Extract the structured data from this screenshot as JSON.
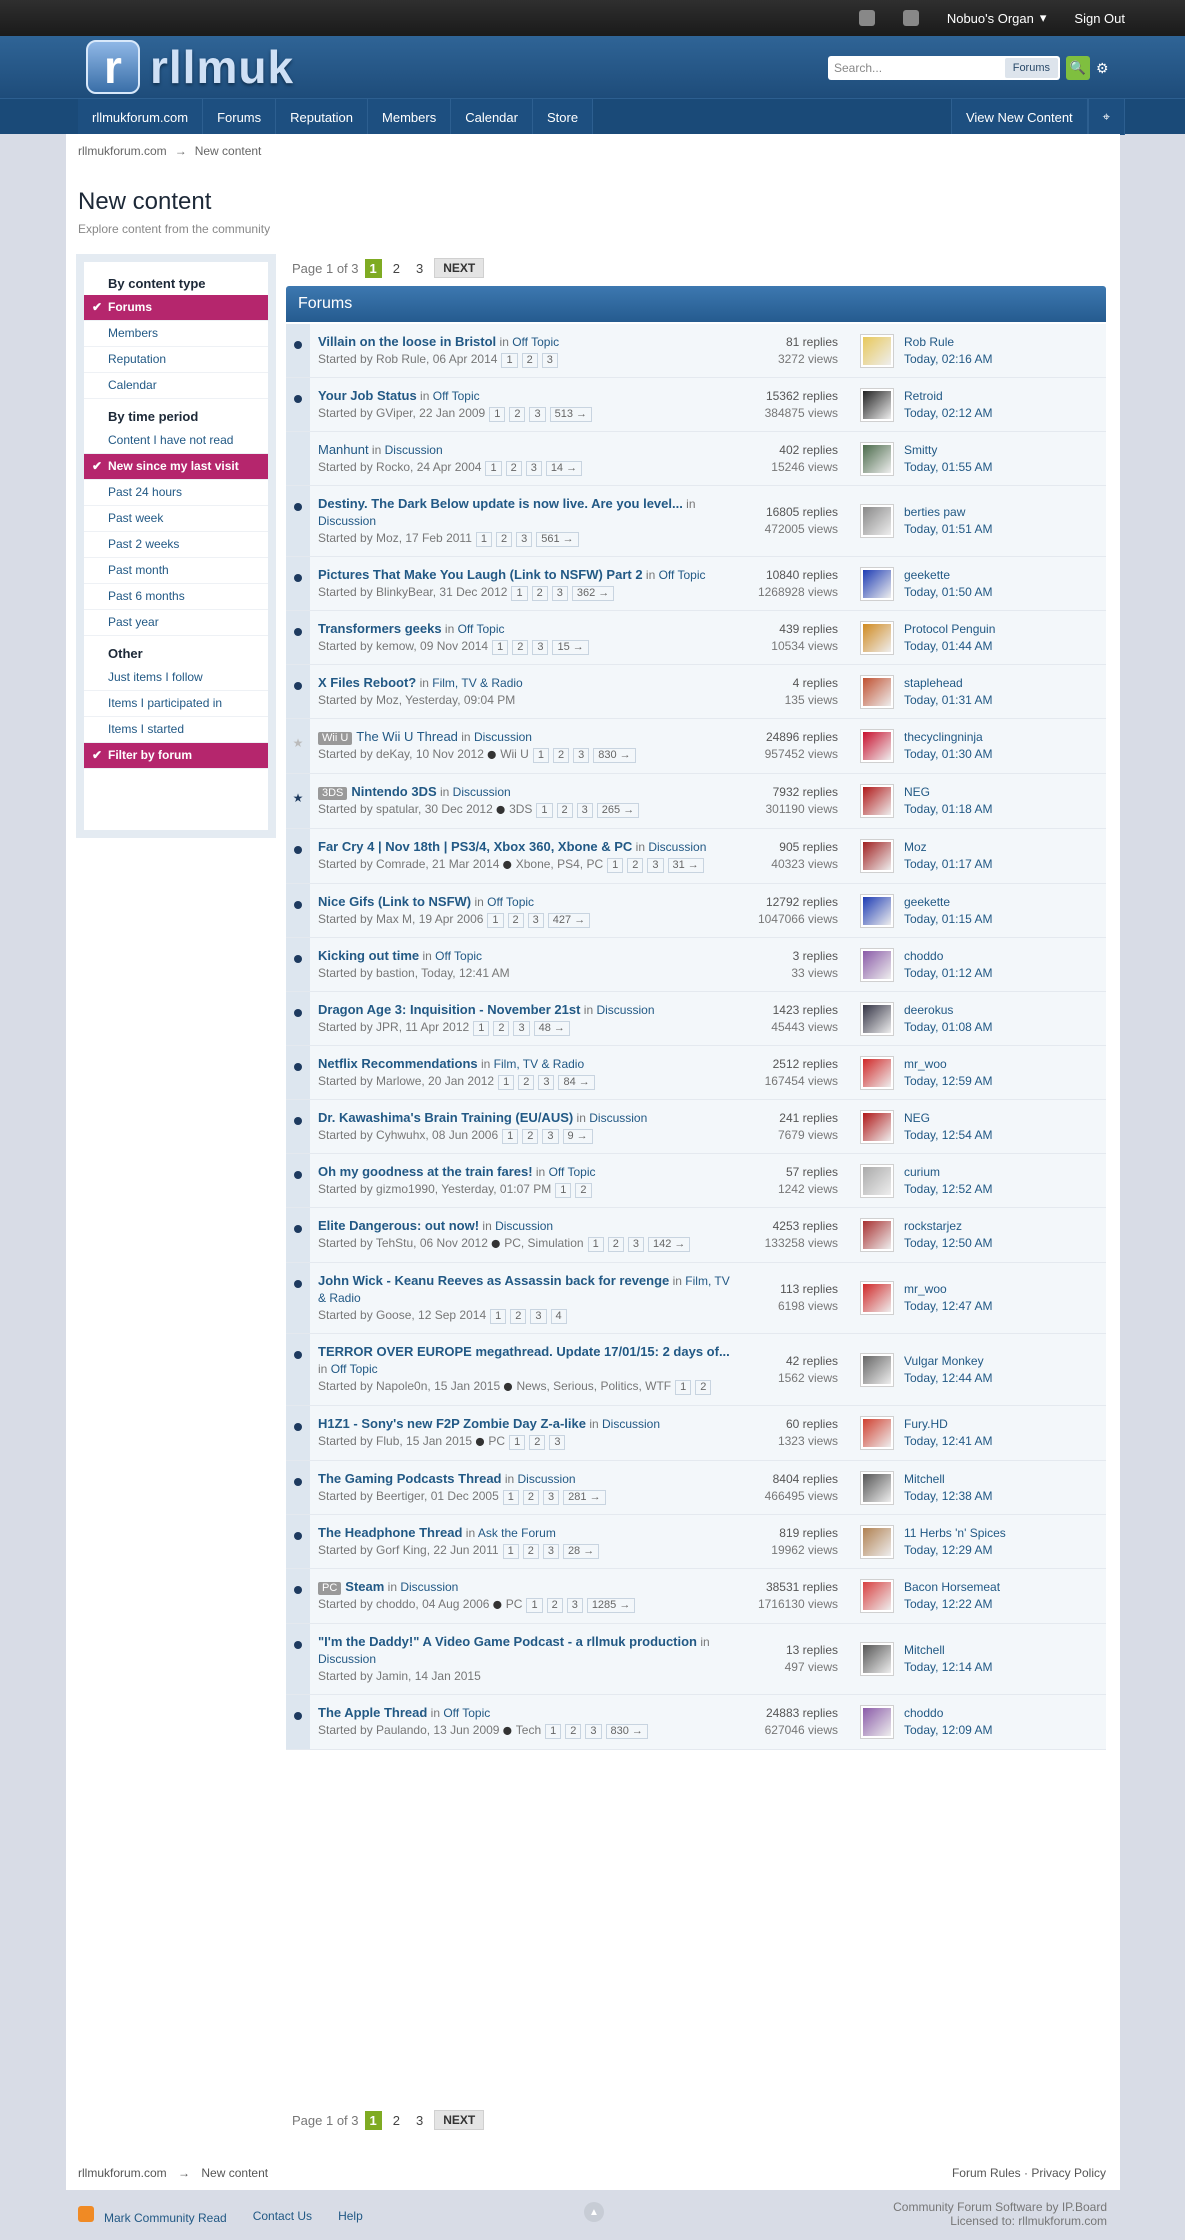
{
  "topbar": {
    "user": "Nobuo's Organ",
    "signout": "Sign Out"
  },
  "header": {
    "logo_letter": "r",
    "logo_text": "rllmuk",
    "search_placeholder": "Search...",
    "search_scope": "Forums"
  },
  "nav": {
    "items": [
      "rllmukforum.com",
      "Forums",
      "Reputation",
      "Members",
      "Calendar",
      "Store"
    ],
    "view_new": "View New Content"
  },
  "breadcrumb": {
    "home": "rllmukforum.com",
    "sep": "→",
    "current": "New content"
  },
  "page": {
    "title": "New content",
    "subtitle": "Explore content from the community"
  },
  "sidebar": {
    "h1": "By content type",
    "type": [
      "Forums",
      "Members",
      "Reputation",
      "Calendar"
    ],
    "h2": "By time period",
    "time": [
      "Content I have not read",
      "New since my last visit",
      "Past 24 hours",
      "Past week",
      "Past 2 weeks",
      "Past month",
      "Past 6 months",
      "Past year"
    ],
    "h3": "Other",
    "other": [
      "Just items I follow",
      "Items I participated in",
      "Items I started",
      "Filter by forum"
    ]
  },
  "pager": {
    "label": "Page 1 of 3",
    "pages": [
      "1",
      "2",
      "3"
    ],
    "next": "NEXT"
  },
  "section": "Forums",
  "topics": [
    {
      "title": "Villain on the loose in Bristol",
      "forum": "Off Topic",
      "starter": "Started by Rob Rule, 06 Apr 2014",
      "pages": [
        "1",
        "2",
        "3"
      ],
      "replies": "81 replies",
      "views": "3272 views",
      "last": "Rob Rule",
      "time": "Today, 02:16 AM",
      "c": "#e8c85a"
    },
    {
      "title": "Your Job Status",
      "forum": "Off Topic",
      "starter": "Started by GViper, 22 Jan 2009",
      "pages": [
        "1",
        "2",
        "3",
        "513 →"
      ],
      "replies": "15362 replies",
      "views": "384875 views",
      "last": "Retroid",
      "time": "Today, 02:12 AM",
      "c": "#222"
    },
    {
      "title": "Manhunt",
      "forum": "Discussion",
      "starter": "Started by Rocko, 24 Apr 2004",
      "pages": [
        "1",
        "2",
        "3",
        "14 →"
      ],
      "replies": "402 replies",
      "views": "15246 views",
      "last": "Smitty",
      "time": "Today, 01:55 AM",
      "c": "#4a6a4a",
      "read": true
    },
    {
      "title": "Destiny. The Dark Below update is now live. Are you level...",
      "forum": "Discussion",
      "starter": "Started by Moz, 17 Feb 2011",
      "pages": [
        "1",
        "2",
        "3",
        "561 →"
      ],
      "replies": "16805 replies",
      "views": "472005 views",
      "last": "berties paw",
      "time": "Today, 01:51 AM",
      "c": "#888"
    },
    {
      "title": "Pictures That Make You Laugh (Link to NSFW) Part 2",
      "forum": "Off Topic",
      "starter": "Started by BlinkyBear, 31 Dec 2012",
      "pages": [
        "1",
        "2",
        "3",
        "362 →"
      ],
      "replies": "10840 replies",
      "views": "1268928 views",
      "last": "geekette",
      "time": "Today, 01:50 AM",
      "c": "#1e3cb4"
    },
    {
      "title": "Transformers geeks",
      "forum": "Off Topic",
      "starter": "Started by kemow, 09 Nov 2014",
      "pages": [
        "1",
        "2",
        "3",
        "15 →"
      ],
      "replies": "439 replies",
      "views": "10534 views",
      "last": "Protocol Penguin",
      "time": "Today, 01:44 AM",
      "c": "#d08a20"
    },
    {
      "title": "X Files Reboot?",
      "forum": "Film, TV & Radio",
      "starter": "Started by Moz, Yesterday, 09:04 PM",
      "pages": [],
      "replies": "4 replies",
      "views": "135 views",
      "last": "staplehead",
      "time": "Today, 01:31 AM",
      "c": "#c05030"
    },
    {
      "prefix": "Wii U",
      "title": "The Wii U Thread",
      "forum": "Discussion",
      "starter": "Started by deKay, 10 Nov 2012",
      "tags": "Wii U",
      "pages": [
        "1",
        "2",
        "3",
        "830 →"
      ],
      "replies": "24896 replies",
      "views": "957452 views",
      "last": "thecyclingninja",
      "time": "Today, 01:30 AM",
      "c": "#c8102e",
      "read": true,
      "star": "grey"
    },
    {
      "prefix": "3DS",
      "title": "Nintendo 3DS",
      "forum": "Discussion",
      "starter": "Started by spatular, 30 Dec 2012",
      "tags": "3DS",
      "pages": [
        "1",
        "2",
        "3",
        "265 →"
      ],
      "replies": "7932 replies",
      "views": "301190 views",
      "last": "NEG",
      "time": "Today, 01:18 AM",
      "c": "#b01818",
      "star": "blue"
    },
    {
      "title": "Far Cry 4 | Nov 18th | PS3/4, Xbox 360, Xbone & PC",
      "forum": "Discussion",
      "starter": "Started by Comrade, 21 Mar 2014",
      "tags": "Xbone, PS4, PC",
      "pages": [
        "1",
        "2",
        "3",
        "31 →"
      ],
      "replies": "905 replies",
      "views": "40323 views",
      "last": "Moz",
      "time": "Today, 01:17 AM",
      "c": "#a02020"
    },
    {
      "title": "Nice Gifs (Link to NSFW)",
      "forum": "Off Topic",
      "starter": "Started by Max M, 19 Apr 2006",
      "pages": [
        "1",
        "2",
        "3",
        "427 →"
      ],
      "replies": "12792 replies",
      "views": "1047066 views",
      "last": "geekette",
      "time": "Today, 01:15 AM",
      "c": "#1e3cb4"
    },
    {
      "title": "Kicking out time",
      "forum": "Off Topic",
      "starter": "Started by bastion, Today, 12:41 AM",
      "pages": [],
      "replies": "3 replies",
      "views": "33 views",
      "last": "choddo",
      "time": "Today, 01:12 AM",
      "c": "#8a5aa8"
    },
    {
      "title": "Dragon Age 3: Inquisition - November 21st",
      "forum": "Discussion",
      "starter": "Started by JPR, 11 Apr 2012",
      "pages": [
        "1",
        "2",
        "3",
        "48 →"
      ],
      "replies": "1423 replies",
      "views": "45443 views",
      "last": "deerokus",
      "time": "Today, 01:08 AM",
      "c": "#334"
    },
    {
      "title": "Netflix Recommendations",
      "forum": "Film, TV & Radio",
      "starter": "Started by Marlowe, 20 Jan 2012",
      "pages": [
        "1",
        "2",
        "3",
        "84 →"
      ],
      "replies": "2512 replies",
      "views": "167454 views",
      "last": "mr_woo",
      "time": "Today, 12:59 AM",
      "c": "#d02828"
    },
    {
      "title": "Dr. Kawashima's Brain Training (EU/AUS)",
      "forum": "Discussion",
      "starter": "Started by Cyhwuhx, 08 Jun 2006",
      "pages": [
        "1",
        "2",
        "3",
        "9 →"
      ],
      "replies": "241 replies",
      "views": "7679 views",
      "last": "NEG",
      "time": "Today, 12:54 AM",
      "c": "#b01818"
    },
    {
      "title": "Oh my goodness at the train fares!",
      "forum": "Off Topic",
      "starter": "Started by gizmo1990, Yesterday, 01:07 PM",
      "pages": [
        "1",
        "2"
      ],
      "replies": "57 replies",
      "views": "1242 views",
      "last": "curium",
      "time": "Today, 12:52 AM",
      "c": "#aaa"
    },
    {
      "title": "Elite Dangerous: out now!",
      "forum": "Discussion",
      "starter": "Started by TehStu, 06 Nov 2012",
      "tags": "PC, Simulation",
      "pages": [
        "1",
        "2",
        "3",
        "142 →"
      ],
      "replies": "4253 replies",
      "views": "133258 views",
      "last": "rockstarjez",
      "time": "Today, 12:50 AM",
      "c": "#a83030"
    },
    {
      "title": "John Wick - Keanu Reeves as Assassin back for revenge",
      "forum": "Film, TV & Radio",
      "starter": "Started by Goose, 12 Sep 2014",
      "pages": [
        "1",
        "2",
        "3",
        "4"
      ],
      "replies": "113 replies",
      "views": "6198 views",
      "last": "mr_woo",
      "time": "Today, 12:47 AM",
      "c": "#d02828"
    },
    {
      "title": "TERROR OVER EUROPE megathread. Update 17/01/15: 2 days of...",
      "forum": "Off Topic",
      "starter": "Started by Napole0n, 15 Jan 2015",
      "tags": "News, Serious, Politics, WTF",
      "pages": [
        "1",
        "2"
      ],
      "replies": "42 replies",
      "views": "1562 views",
      "last": "Vulgar Monkey",
      "time": "Today, 12:44 AM",
      "c": "#666"
    },
    {
      "title": "H1Z1 - Sony's new F2P Zombie Day Z-a-like",
      "forum": "Discussion",
      "starter": "Started by Flub, 15 Jan 2015",
      "tags": "PC",
      "pages": [
        "1",
        "2",
        "3"
      ],
      "replies": "60 replies",
      "views": "1323 views",
      "last": "Fury.HD",
      "time": "Today, 12:41 AM",
      "c": "#d04030"
    },
    {
      "title": "The Gaming Podcasts Thread",
      "forum": "Discussion",
      "starter": "Started by Beertiger, 01 Dec 2005",
      "pages": [
        "1",
        "2",
        "3",
        "281 →"
      ],
      "replies": "8404 replies",
      "views": "466495 views",
      "last": "Mitchell",
      "time": "Today, 12:38 AM",
      "c": "#555"
    },
    {
      "title": "The Headphone Thread",
      "forum": "Ask the Forum",
      "starter": "Started by Gorf King, 22 Jun 2011",
      "pages": [
        "1",
        "2",
        "3",
        "28 →"
      ],
      "replies": "819 replies",
      "views": "19962 views",
      "last": "11 Herbs 'n' Spices",
      "time": "Today, 12:29 AM",
      "c": "#b08050"
    },
    {
      "prefix": "PC",
      "title": "Steam",
      "forum": "Discussion",
      "starter": "Started by choddo, 04 Aug 2006",
      "tags": "PC",
      "pages": [
        "1",
        "2",
        "3",
        "1285 →"
      ],
      "replies": "38531 replies",
      "views": "1716130 views",
      "last": "Bacon Horsemeat",
      "time": "Today, 12:22 AM",
      "c": "#d84040"
    },
    {
      "title": "\"I'm the Daddy!\" A Video Game Podcast - a rllmuk production",
      "forum": "Discussion",
      "starter": "Started by Jamin, 14 Jan 2015",
      "pages": [],
      "replies": "13 replies",
      "views": "497 views",
      "last": "Mitchell",
      "time": "Today, 12:14 AM",
      "c": "#555"
    },
    {
      "title": "The Apple Thread",
      "forum": "Off Topic",
      "starter": "Started by Paulando, 13 Jun 2009",
      "tags": "Tech",
      "pages": [
        "1",
        "2",
        "3",
        "830 →"
      ],
      "replies": "24883 replies",
      "views": "627046 views",
      "last": "choddo",
      "time": "Today, 12:09 AM",
      "c": "#8a5aa8"
    }
  ],
  "footer": {
    "rules": "Forum Rules",
    "privacy": "Privacy Policy",
    "mark": "Mark Community Read",
    "contact": "Contact Us",
    "help": "Help",
    "software": "Community Forum Software by IP.Board",
    "license": "Licensed to: rllmukforum.com"
  }
}
